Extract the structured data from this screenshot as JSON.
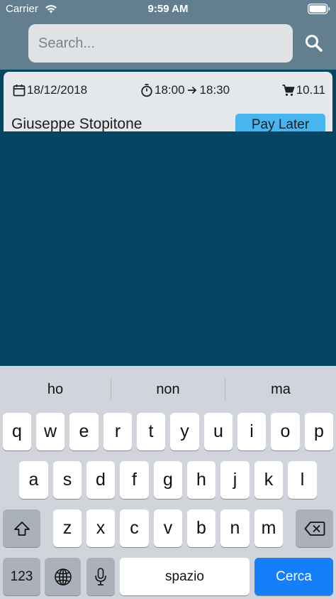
{
  "status_bar": {
    "carrier": "Carrier",
    "time": "9:59 AM",
    "wifi_icon": "wifi-icon",
    "battery_icon": "battery-icon"
  },
  "search": {
    "placeholder": "Search...",
    "value": "",
    "button_icon": "search-icon"
  },
  "order": {
    "date": "18/12/2018",
    "time_start": "18:00",
    "time_end": "18:30",
    "total": "10.11",
    "customer": "Giuseppe Stopitone",
    "pay_later_label": "Pay Later",
    "icons": [
      "calendar-icon",
      "stopwatch-icon",
      "arrow-right-icon",
      "cart-icon"
    ]
  },
  "keyboard": {
    "suggestions": [
      "ho",
      "non",
      "ma"
    ],
    "rows": [
      [
        "q",
        "w",
        "e",
        "r",
        "t",
        "y",
        "u",
        "i",
        "o",
        "p"
      ],
      [
        "a",
        "s",
        "d",
        "f",
        "g",
        "h",
        "j",
        "k",
        "l"
      ],
      [
        "z",
        "x",
        "c",
        "v",
        "b",
        "n",
        "m"
      ]
    ],
    "numbers_label": "123",
    "space_label": "spazio",
    "go_label": "Cerca",
    "icons": [
      "shift-icon",
      "backspace-icon",
      "globe-icon",
      "microphone-icon"
    ],
    "colors": {
      "background": "#d1d5db",
      "key": "#ffffff",
      "special_key": "#abb1ba",
      "go_key": "#147efb"
    }
  },
  "colors": {
    "header": "#637f8f",
    "body": "#054561",
    "card": "#e5e8ea",
    "pay_later": "#48b5ef"
  }
}
